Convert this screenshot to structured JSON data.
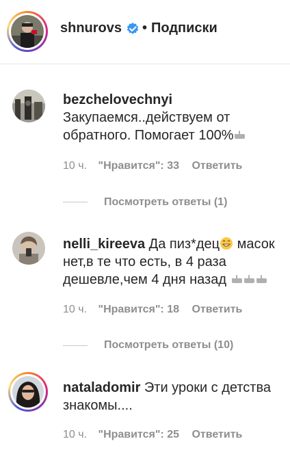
{
  "header": {
    "username": "shnurovs",
    "separator": "•",
    "follow_label": "Подписки"
  },
  "comments": [
    {
      "username": "bezchelovechnyi",
      "text_line1": "Закупаемся..действуем от",
      "text_line2": "обратного. Помогает 100%",
      "time": "10 ч.",
      "likes": "\"Нравится\": 33",
      "reply_label": "Ответить",
      "view_replies": "Посмотреть ответы (1)"
    },
    {
      "username": "nelli_kireeva",
      "text_line1": "Да пиз*дец",
      "text_line1b": "масок",
      "text_line2": "нет,в те что есть, в 4 раза",
      "text_line3": "дешевле,чем 4 дня назад",
      "time": "10 ч.",
      "likes": "\"Нравится\": 18",
      "reply_label": "Ответить",
      "view_replies": "Посмотреть ответы (10)"
    },
    {
      "username": "nataladomir",
      "text_line1": "Эти уроки с детства",
      "text_line2": "знакомы....",
      "time": "10 ч.",
      "likes": "\"Нравится\": 25",
      "reply_label": "Ответить"
    }
  ],
  "colors": {
    "text": "#262626",
    "meta": "#8e8e8e",
    "verified": "#3897f0"
  }
}
